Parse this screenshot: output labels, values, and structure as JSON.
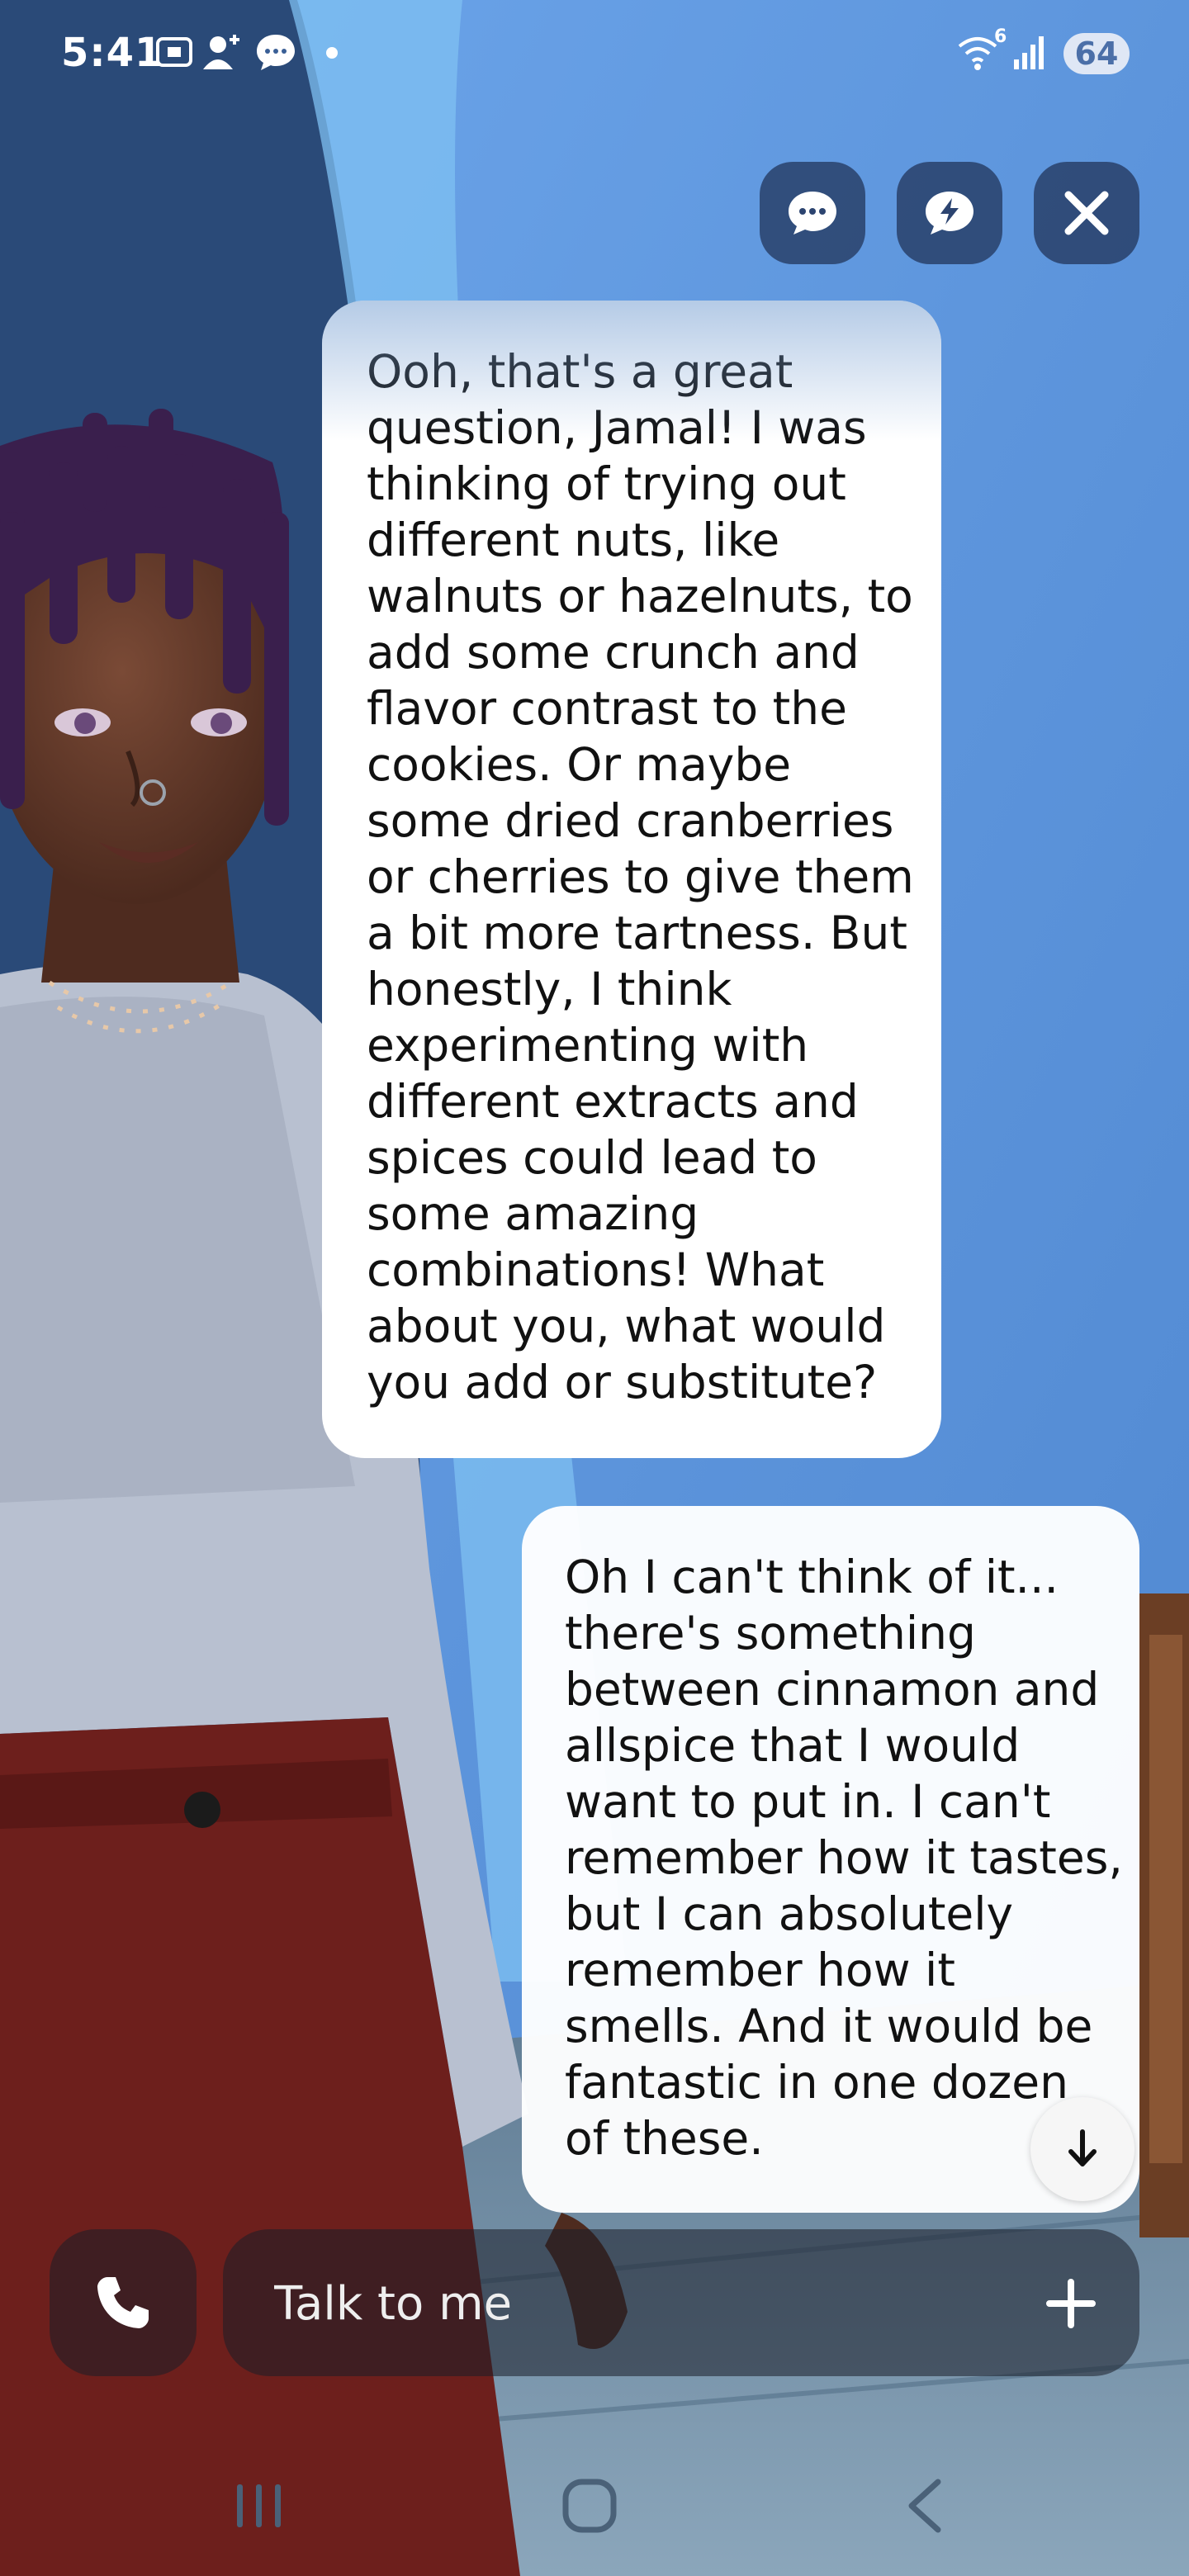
{
  "status_bar": {
    "time": "5:41",
    "battery": "64",
    "wifi_badge": "6",
    "icons": [
      "screenshot-icon",
      "contact-add-icon",
      "messages-icon",
      "dot-icon",
      "wifi-icon",
      "signal-icon",
      "battery-icon"
    ]
  },
  "top_actions": [
    {
      "name": "chat-mode-button",
      "icon": "chat-bubble-icon"
    },
    {
      "name": "quick-reply-button",
      "icon": "lightning-bubble-icon"
    },
    {
      "name": "close-button",
      "icon": "close-icon"
    }
  ],
  "messages": [
    {
      "sender": "ai",
      "text": "Ooh, that's a great question, Jamal! I was thinking of trying out different nuts, like walnuts or hazelnuts, to add some crunch and flavor contrast to the cookies. Or maybe some dried cranberries or cherries to give them a bit more tartness. But honestly, I think experimenting with different extracts and spices could lead to some amazing combinations! What about you, what would you add or substitute?"
    },
    {
      "sender": "user",
      "text": "Oh I can't think of it... there's something between cinnamon and allspice that I would want to put in. I can't remember how it tastes, but I can absolutely remember how it smells. And it would be fantastic in one  dozen of these."
    }
  ],
  "composer": {
    "placeholder": "Talk to me",
    "call_icon": "phone-icon",
    "add_icon": "plus-icon"
  },
  "scroll_down_icon": "arrow-down-icon",
  "nav_bar": [
    "recents-icon",
    "home-icon",
    "back-icon"
  ]
}
